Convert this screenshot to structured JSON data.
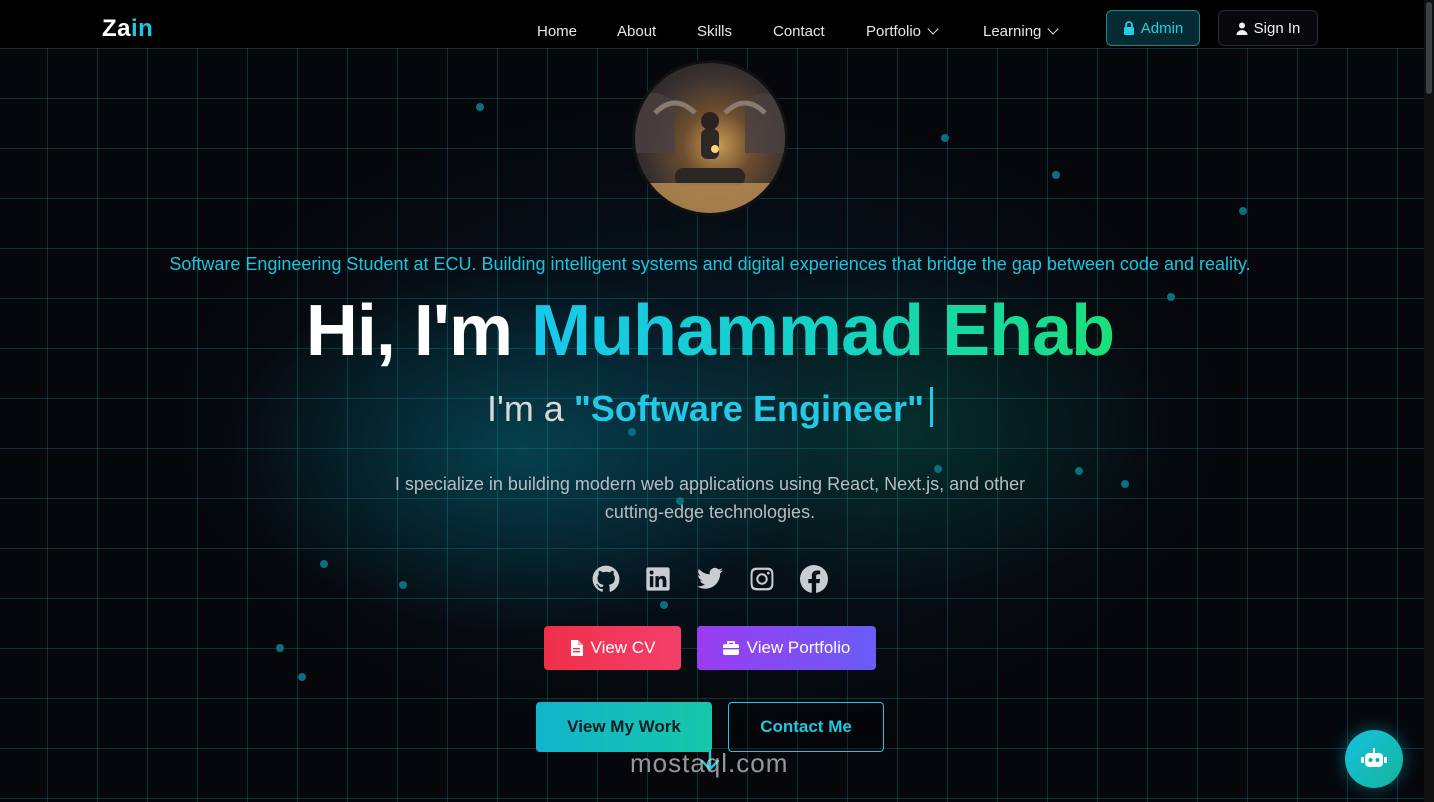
{
  "nav": {
    "logo_part1": "Za",
    "logo_part2": "in",
    "items": [
      "Home",
      "About",
      "Skills",
      "Contact",
      "Portfolio",
      "Learning"
    ],
    "admin_label": "Admin",
    "signin_label": "Sign In"
  },
  "hero": {
    "tagline": "Software Engineering Student at ECU. Building intelligent systems and digital experiences that bridge the gap between code and reality.",
    "greeting": "Hi, I'm",
    "name": "Muhammad Ehab",
    "role_prefix": "I'm a",
    "role": "\"Software Engineer\"",
    "description": "I specialize in building modern web applications using React, Next.js, and other cutting-edge technologies."
  },
  "social": [
    "github-icon",
    "linkedin-icon",
    "twitter-icon",
    "instagram-icon",
    "facebook-icon"
  ],
  "buttons": {
    "view_cv": "View CV",
    "view_portfolio": "View Portfolio",
    "view_work": "View My Work",
    "contact_me": "Contact Me"
  },
  "watermark": "mostaql.com",
  "colors": {
    "accent": "#19c6e0",
    "green": "#1ae07a",
    "cv_red": "#f0304a",
    "portfolio_purple": "#9a3cf2"
  }
}
